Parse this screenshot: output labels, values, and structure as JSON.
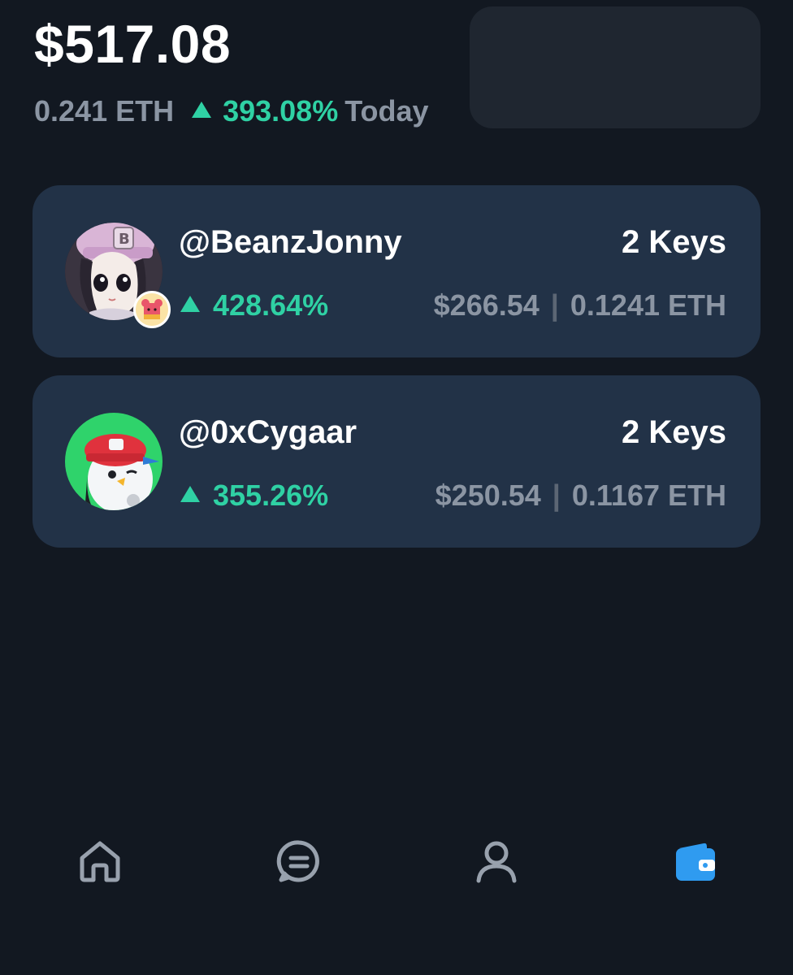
{
  "summary": {
    "balance_usd": "$517.08",
    "balance_eth": "0.241 ETH",
    "change_percent": "393.08%",
    "change_period": "Today",
    "change_direction_icon": "triangle-up-icon"
  },
  "holdings": [
    {
      "handle": "@BeanzJonny",
      "keys": "2 Keys",
      "change_percent": "428.64%",
      "value_usd": "$266.54",
      "value_eth": "0.1241 ETH",
      "separator": "|",
      "avatar": "anime-girl-pink-cap-avatar",
      "badge": "bear-badge-icon"
    },
    {
      "handle": "@0xCygaar",
      "keys": "2 Keys",
      "change_percent": "355.26%",
      "value_usd": "$250.54",
      "value_eth": "0.1167 ETH",
      "separator": "|",
      "avatar": "penguin-red-cap-avatar"
    }
  ],
  "nav": {
    "items": [
      {
        "icon": "home-icon",
        "active": false
      },
      {
        "icon": "chat-icon",
        "active": false
      },
      {
        "icon": "profile-icon",
        "active": false
      },
      {
        "icon": "wallet-icon",
        "active": true
      }
    ]
  },
  "colors": {
    "background": "#121821",
    "card": "#223247",
    "positive": "#2fd1a4",
    "muted": "#8b95a3",
    "active_nav": "#2f9bf0",
    "inactive_nav": "#98a1ad"
  }
}
